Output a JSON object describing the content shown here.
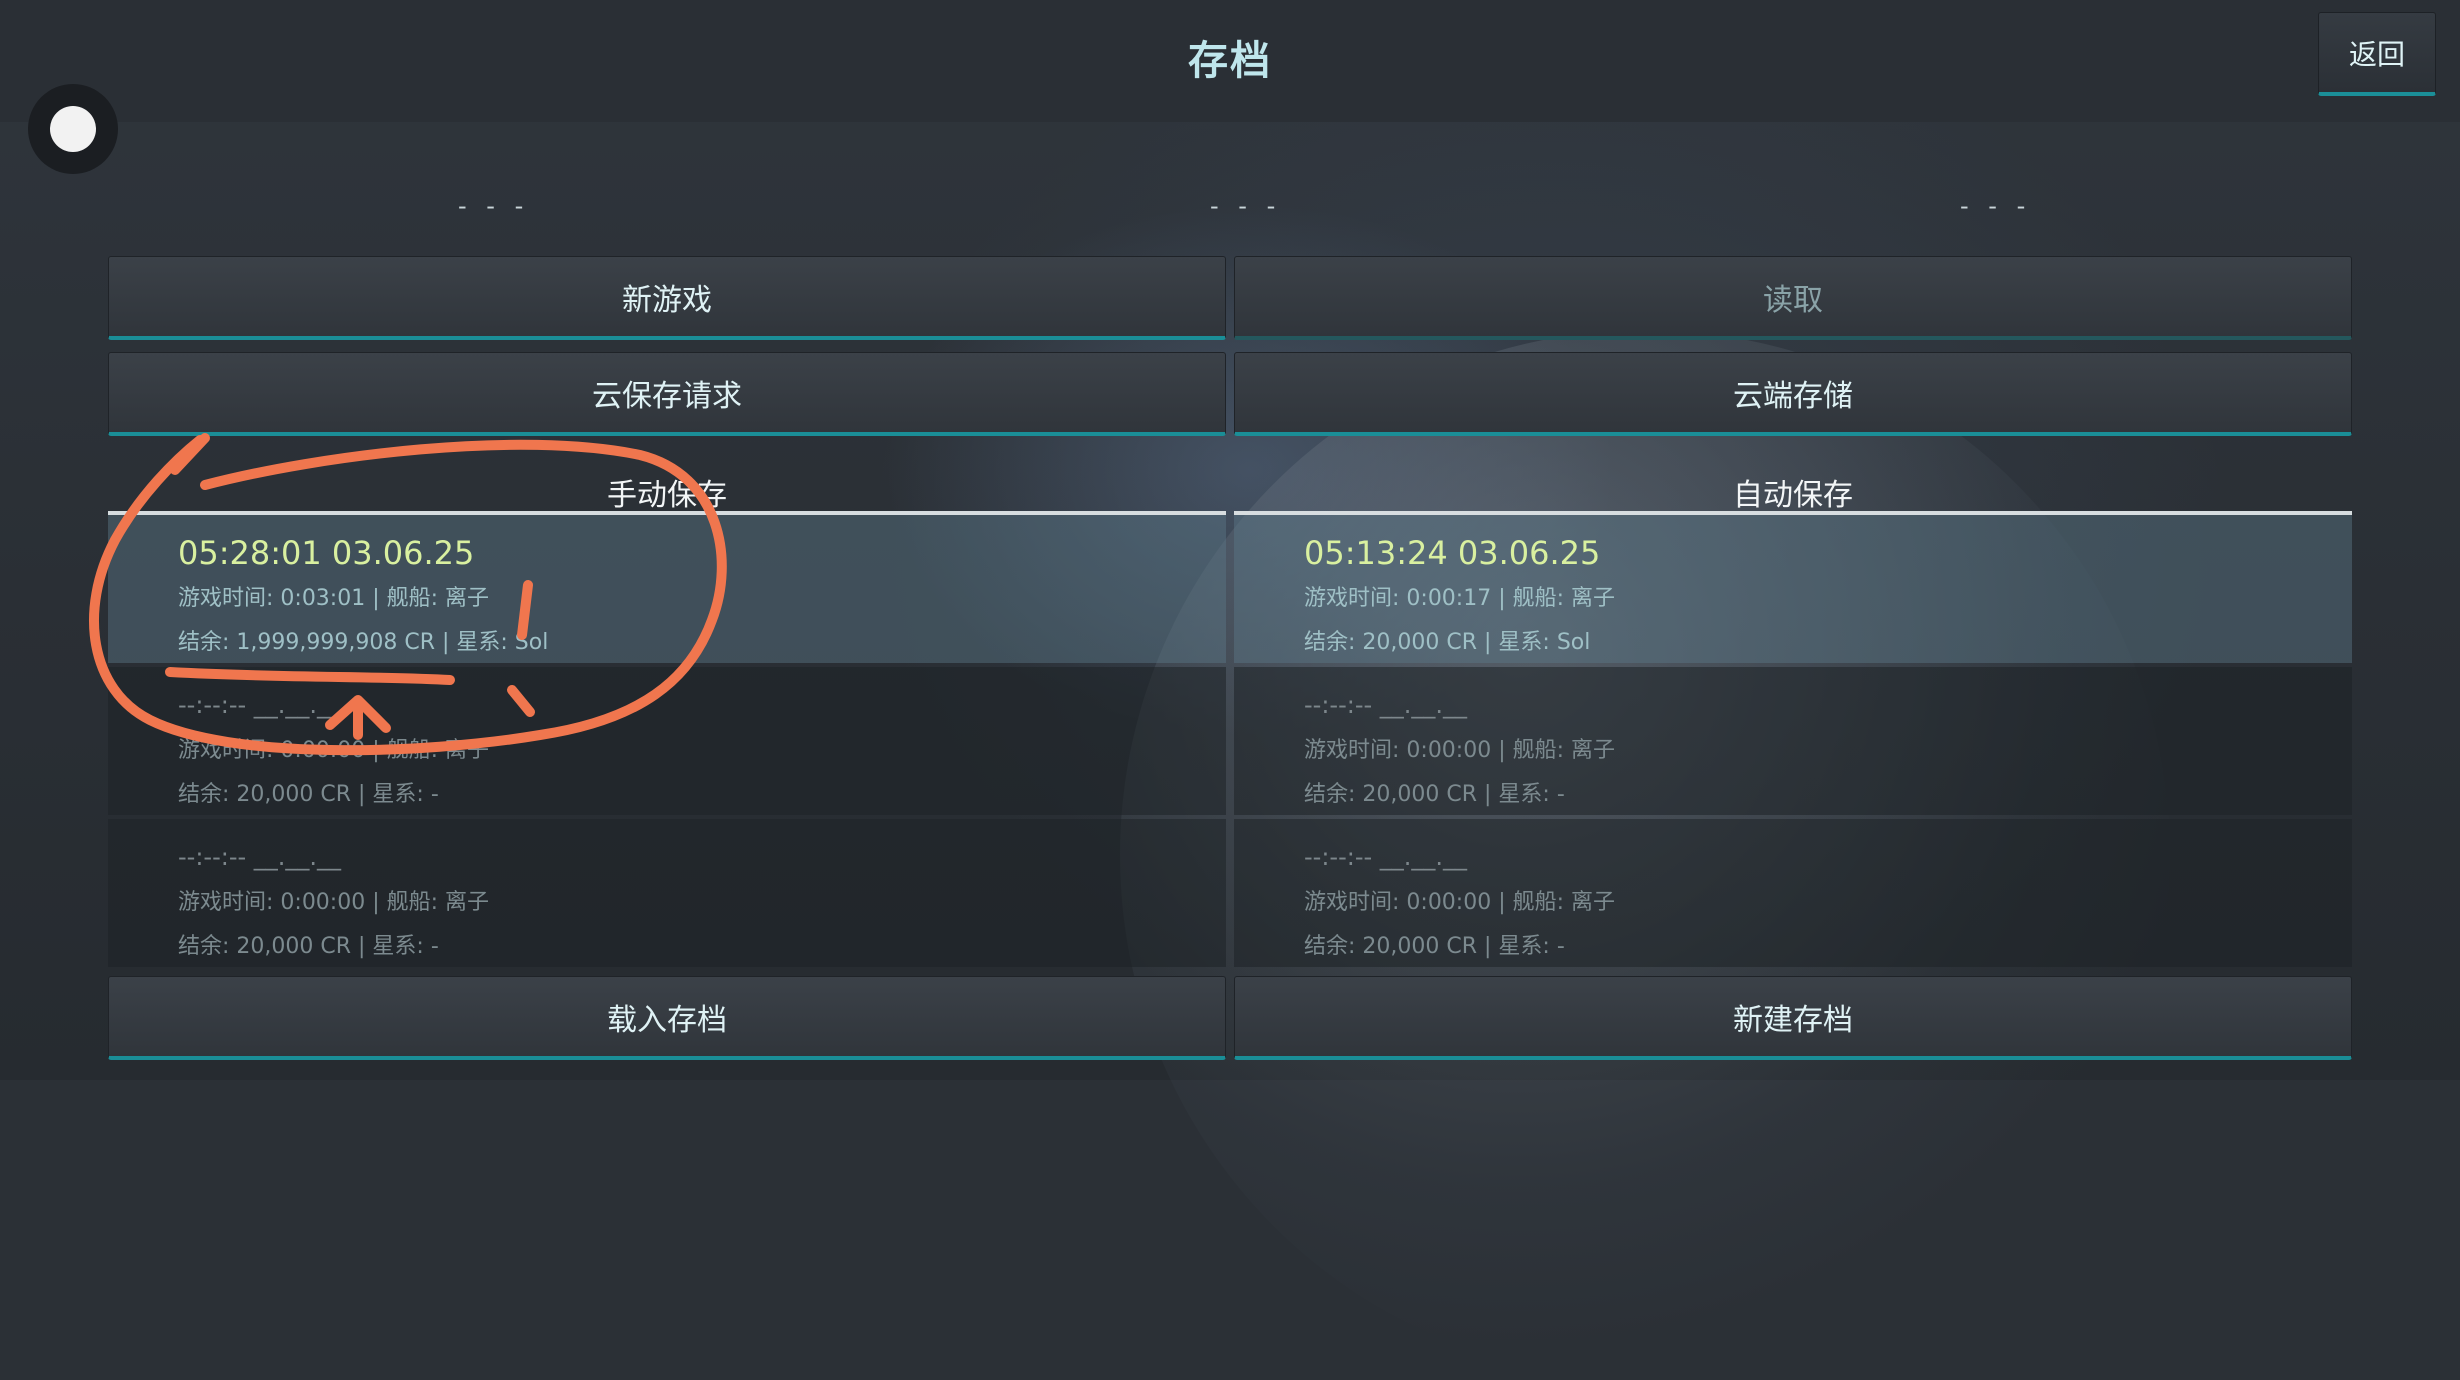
{
  "header": {
    "title": "存档",
    "back_label": "返回"
  },
  "slot_placeholders": [
    "- - -",
    "- - -",
    "- - -"
  ],
  "buttons": {
    "new_game": "新游戏",
    "load": "读取",
    "cloud_save_request": "云保存请求",
    "cloud_storage": "云端存储",
    "load_save": "载入存档",
    "new_save": "新建存档"
  },
  "manual": {
    "title": "手动保存",
    "slots": [
      {
        "time": "05:28:01 03.06.25",
        "line1": "游戏时间: 0:03:01 | 舰船: 离子",
        "line2": "结余: 1,999,999,908 CR | 星系: Sol"
      },
      {
        "time": "--:--:--   __.__.__",
        "line1": "游戏时间: 0:00:00 | 舰船: 离子",
        "line2": "结余: 20,000 CR | 星系: -"
      },
      {
        "time": "--:--:--   __.__.__",
        "line1": "游戏时间: 0:00:00 | 舰船: 离子",
        "line2": "结余: 20,000 CR | 星系: -"
      }
    ]
  },
  "auto": {
    "title": "自动保存",
    "slots": [
      {
        "time": "05:13:24 03.06.25",
        "line1": "游戏时间: 0:00:17 | 舰船: 离子",
        "line2": "结余: 20,000 CR | 星系: Sol"
      },
      {
        "time": "--:--:--   __.__.__",
        "line1": "游戏时间: 0:00:00 | 舰船: 离子",
        "line2": "结余: 20,000 CR | 星系: -"
      },
      {
        "time": "--:--:--   __.__.__",
        "line1": "游戏时间: 0:00:00 | 舰船: 离子",
        "line2": "结余: 20,000 CR | 星系: -"
      }
    ]
  },
  "colors": {
    "accent": "#1a8e97",
    "highlight_text": "#d9f0a0",
    "annotation": "#f0764e"
  }
}
